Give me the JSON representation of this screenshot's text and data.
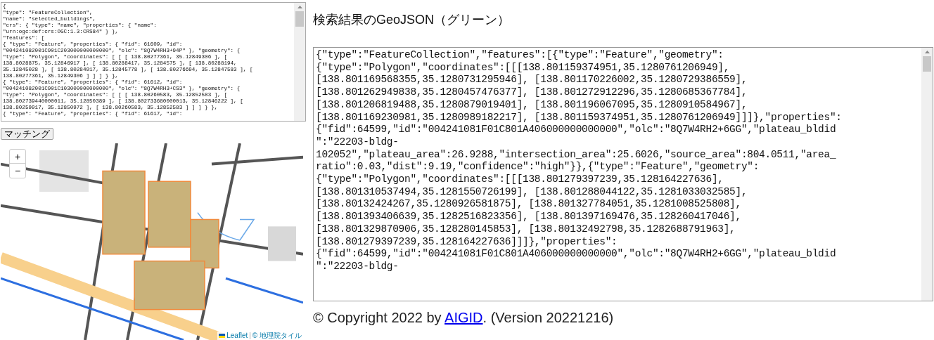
{
  "source_geojson": {
    "value": "{\n\"type\": \"FeatureCollection\",\n\"name\": \"selected_buildings\",\n\"crs\": { \"type\": \"name\", \"properties\": { \"name\":\n\"urn:ogc:def:crs:OGC:1.3:CRS84\" } },\n\"features\": [\n{ \"type\": \"Feature\", \"properties\": { \"fid\": 61609, \"id\":\n\"004241082001C901C203000000000000\", \"olc\": \"8Q7W4RH3+94P\" }, \"geometry\": {\n\"type\": \"Polygon\", \"coordinates\": [ [ [ 138.80277361, 35.12849306 ], [\n138.8028875, 35.12846917 ], [ 138.80288417, 35.1284575 ], [ 138.80288194,\n35.12845028 ], [ 138.80284917, 35.12845778 ], [ 138.80276694, 35.12847583 ], [\n138.80277361, 35.12849306 ] ] ] } },\n{ \"type\": \"Feature\", \"properties\": { \"fid\": 61612, \"id\":\n\"004241082001C901C103000000000000\", \"olc\": \"8Q7W4RH3+CS3\" }, \"geometry\": {\n\"type\": \"Polygon\", \"coordinates\": [ [ [ 138.80260583, 35.12852583 ], [\n138.802739440000011, 35.12850389 ], [ 138.802733680000013, 35.12846222 ], [\n138.80259917, 35.12850972 ], [ 138.80260583, 35.12852583 ] ] ] } },\n{ \"type\": \"Feature\", \"properties\": { \"fid\": 61617, \"id\":"
  },
  "match_button": "マッチング",
  "map": {
    "zoom_in": "+",
    "zoom_out": "−",
    "attribution": {
      "leaflet": "Leaflet",
      "separator": "|",
      "tiles": "© 地理院タイル"
    }
  },
  "result": {
    "title": "検索結果のGeoJSON（グリーン）",
    "value": "{\"type\":\"FeatureCollection\",\"features\":[{\"type\":\"Feature\",\"geometry\":\n{\"type\":\"Polygon\",\"coordinates\":[[[138.801159374951,35.1280761206949],\n[138.801169568355,35.1280731295946], [138.801170226002,35.1280729386559],\n[138.801262949838,35.1280457476377], [138.801272912296,35.1280685367784],\n[138.801206819488,35.1280879019401], [138.801196067095,35.1280910584967],\n[138.801169230981,35.1280989182217], [138.801159374951,35.1280761206949]]]},\"properties\":\n{\"fid\":64599,\"id\":\"004241081F01C801A406000000000000\",\"olc\":\"8Q7W4RH2+6GG\",\"plateau_bldid\n\":\"22203-bldg-\n102052\",\"plateau_area\":26.9288,\"intersection_area\":25.6026,\"source_area\":804.0511,\"area_\nratio\":0.03,\"dist\":9.19,\"confidence\":\"high\"}},{\"type\":\"Feature\",\"geometry\":\n{\"type\":\"Polygon\",\"coordinates\":[[[138.801279397239,35.128164227636],\n[138.801310537494,35.1281550726199], [138.801288044122,35.1281033032585],\n[138.80132424267,35.1280926581875], [138.801327784051,35.1281008525808],\n[138.801393406639,35.1282516823356], [138.801397169476,35.128260417046],\n[138.801329870906,35.128280145853], [138.80132492798,35.1282688791963],\n[138.801279397239,35.128164227636]]]},\"properties\":\n{\"fid\":64599,\"id\":\"004241081F01C801A406000000000000\",\"olc\":\"8Q7W4RH2+6GG\",\"plateau_bldid\n\":\"22203-bldg-"
  },
  "footer": {
    "before": "© Copyright 2022 by",
    "link": "AIGID",
    "after": ". (Version 20221216)"
  }
}
